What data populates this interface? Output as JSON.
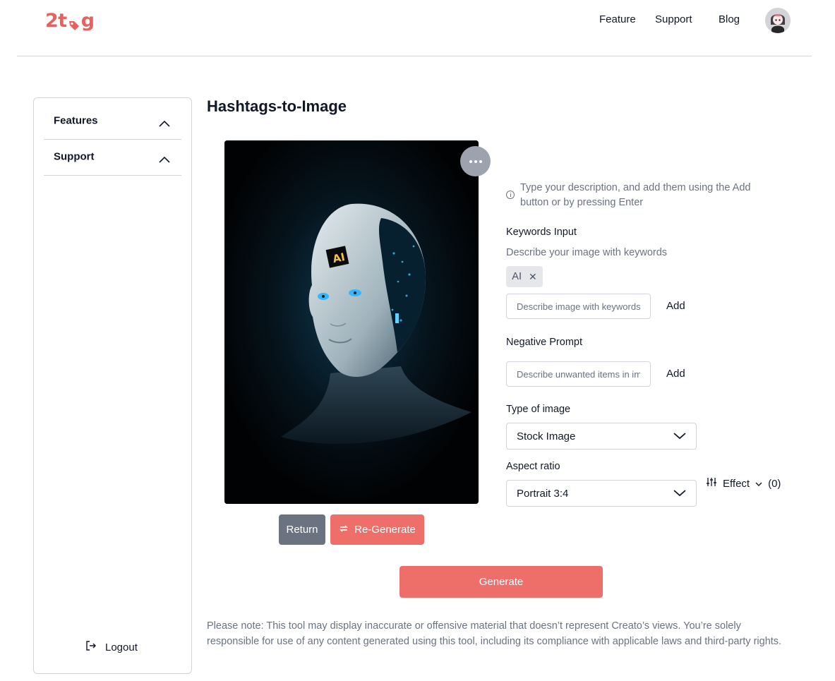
{
  "header": {
    "logo_prefix": "2t",
    "logo_suffix": "g",
    "nav": [
      "Feature",
      "Support",
      "Blog"
    ],
    "brand_color": "#e8615f"
  },
  "sidebar": {
    "items": [
      {
        "label": "Features",
        "icon": "chevron-up-icon"
      },
      {
        "label": "Support",
        "icon": "chevron-up-icon"
      }
    ],
    "logout_label": "Logout",
    "logout_icon": "logout-icon"
  },
  "main": {
    "title": "Hashtags-to-Image",
    "image": {
      "alt": "ai-robot-head-image",
      "menu_icon": "more-horizontal-icon"
    },
    "return_label": "Return",
    "regenerate_label": "Re-Generate",
    "hint": "Type your description, and add them using the Add button or by pressing Enter",
    "keywords_label": "Keywords Input",
    "keywords_sublabel": "Describe your image with keywords",
    "keyword_tags": [
      "AI"
    ],
    "keywords_placeholder": "Describe image with keywords",
    "add_label": "Add",
    "negative_label": "Negative Prompt",
    "negative_placeholder": "Describe unwanted items in image",
    "type_label": "Type of image",
    "type_value": "Stock Image",
    "aspect_label": "Aspect ratio",
    "aspect_value": "Portrait 3:4",
    "effect_label": "Effect",
    "effect_count": "(0)",
    "generate_label": "Generate",
    "note": "Please note: This tool may display inaccurate or offensive material that doesn’t represent Creato’s views. You’re solely responsible for use of any content generated using this tool, including its compliance with applicable laws and third-party rights.",
    "accent_color": "#ee6e69",
    "secondary_color": "#6b7280"
  }
}
